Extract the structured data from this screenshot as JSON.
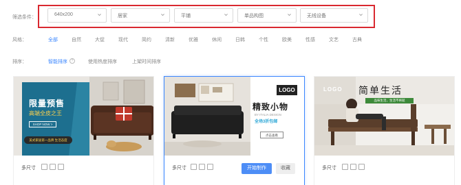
{
  "filters": {
    "label": "筛选条件：",
    "selects": [
      {
        "value": "640x200"
      },
      {
        "value": "居家"
      },
      {
        "value": "平铺"
      },
      {
        "value": "单品构图"
      },
      {
        "value": "无线设备"
      }
    ]
  },
  "style_row": {
    "label": "风格：",
    "options": [
      "全部",
      "自然",
      "大促",
      "现代",
      "简约",
      "清新",
      "优雅",
      "休闲",
      "日韩",
      "个性",
      "欧美",
      "性感",
      "文艺",
      "古典"
    ],
    "active": "全部"
  },
  "sort_row": {
    "label": "排序：",
    "options": [
      "智能排序",
      "使用热度排序",
      "上架时间排序"
    ],
    "active": "智能排序",
    "help_glyph": "?"
  },
  "cards": [
    {
      "banner": {
        "title": "限量预售",
        "subtitle": "高端全皮之王",
        "button": "SHOP NOW >",
        "tag": "美式家居第一品牌 生活态度"
      },
      "footer": {
        "sizes_label": "多尺寸"
      }
    },
    {
      "banner": {
        "logo": "LOGO",
        "title": "精致小物",
        "brand": "BY ITALIA DESIGN",
        "promo": "全场3折包邮",
        "view": "点击查看"
      },
      "footer": {
        "sizes_label": "多尺寸",
        "make_button": "开始制作",
        "fav_button": "收藏"
      }
    },
    {
      "banner": {
        "logo": "LOGO",
        "title": "简单生活",
        "subtitle": "品味生活，生活不将就"
      },
      "footer": {
        "sizes_label": "多尺寸"
      }
    }
  ],
  "colors": {
    "accent": "#3a86ff",
    "highlight_border": "#d9282f",
    "make_button": "#4d8df6"
  }
}
